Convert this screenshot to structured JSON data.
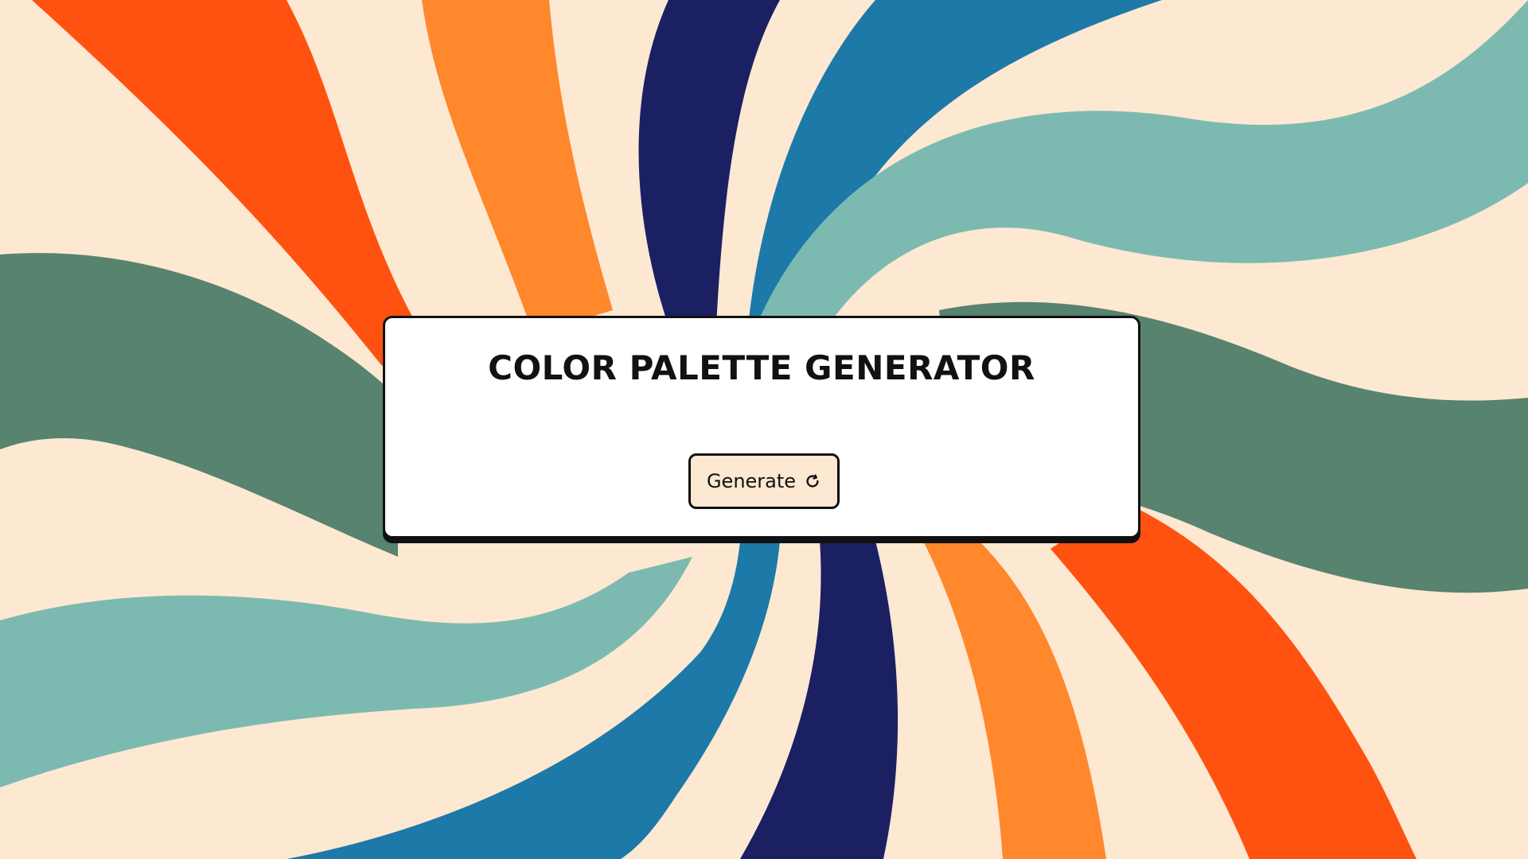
{
  "app": {
    "title": "COLOR PALETTE GENERATOR"
  },
  "actions": {
    "generate_label": "Generate",
    "generate_icon": "refresh-icon"
  },
  "colors": {
    "background_cream": "#fde8d1",
    "orange_red": "#ff5210",
    "orange": "#ff872c",
    "navy": "#1b2063",
    "blue": "#1d79a8",
    "teal": "#7cbab1",
    "sage_green": "#57836f",
    "card_background": "#ffffff",
    "border": "#111111"
  }
}
